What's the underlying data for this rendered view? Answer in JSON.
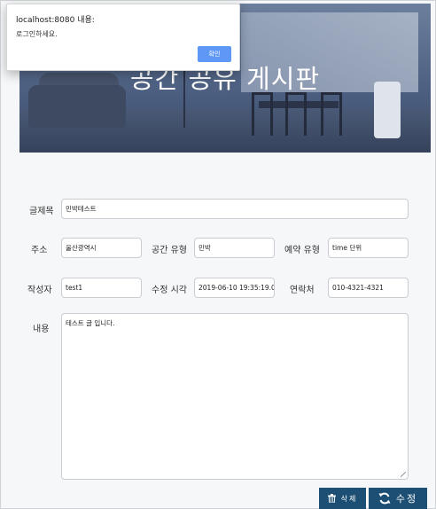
{
  "hero": {
    "title": "공간 공유 게시판"
  },
  "dialog": {
    "title": "localhost:8080 내용:",
    "message": "로그인하세요.",
    "ok_label": "확인",
    "ok_color": "#5e97f6"
  },
  "form": {
    "title": {
      "label": "글제목",
      "value": "민박테스트"
    },
    "address": {
      "label": "주소",
      "value": "울산광역시"
    },
    "space_type": {
      "label": "공간 유형",
      "value": "민박"
    },
    "reservation_type": {
      "label": "예약 유형",
      "value": "time 단위"
    },
    "author": {
      "label": "작성자",
      "value": "test1"
    },
    "modified_time": {
      "label": "수정 시각",
      "value": "2019-06-10 19:35:19.0"
    },
    "contact": {
      "label": "연락처",
      "value": "010-4321-4321"
    },
    "content": {
      "label": "내용",
      "value": "테스트 글 입니다."
    }
  },
  "actions": {
    "delete": {
      "label": "삭제",
      "icon": "trash-icon"
    },
    "edit": {
      "label": "수정",
      "icon": "refresh-icon"
    },
    "button_color": "#1d4e73"
  }
}
